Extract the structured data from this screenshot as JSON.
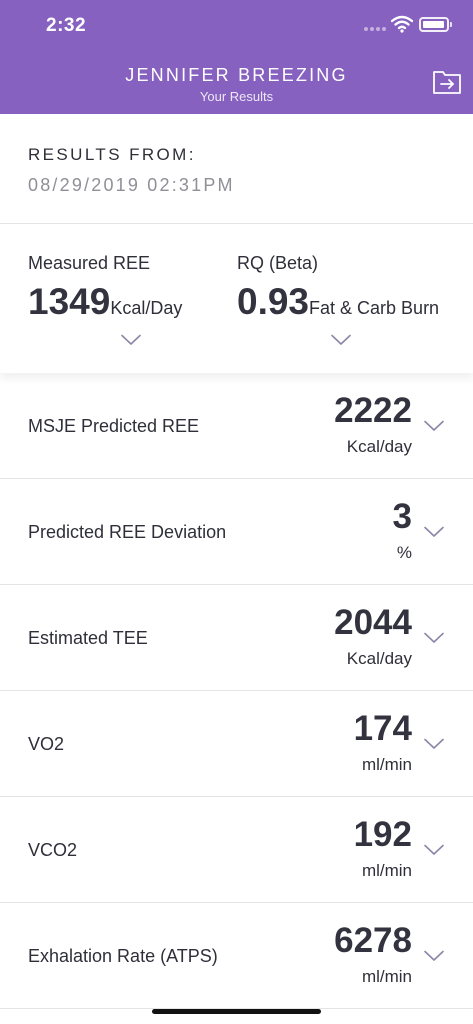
{
  "status_bar": {
    "time": "2:32"
  },
  "header": {
    "title": "JENNIFER BREEZING",
    "subtitle": "Your Results"
  },
  "results": {
    "label": "RESULTS FROM:",
    "date": "08/29/2019 02:31PM"
  },
  "summary": {
    "measured_ree": {
      "label": "Measured REE",
      "value": "1349",
      "unit": "Kcal/Day"
    },
    "rq": {
      "label": "RQ (Beta)",
      "value": "0.93",
      "unit": "Fat & Carb Burn"
    }
  },
  "metrics": [
    {
      "label": "MSJE Predicted REE",
      "value": "2222",
      "unit": "Kcal/day"
    },
    {
      "label": "Predicted REE Deviation",
      "value": "3",
      "unit": "%"
    },
    {
      "label": "Estimated TEE",
      "value": "2044",
      "unit": "Kcal/day"
    },
    {
      "label": "VO2",
      "value": "174",
      "unit": "ml/min"
    },
    {
      "label": "VCO2",
      "value": "192",
      "unit": "ml/min"
    },
    {
      "label": "Exhalation Rate (ATPS)",
      "value": "6278",
      "unit": "ml/min"
    }
  ],
  "icons": {
    "export": "export-icon",
    "chevron": "chevron-down-icon",
    "wifi": "wifi-icon",
    "battery": "battery-icon"
  },
  "colors": {
    "header": "#8661bf",
    "chevron": "#8b86a8",
    "muted_text": "#8f8f97"
  }
}
